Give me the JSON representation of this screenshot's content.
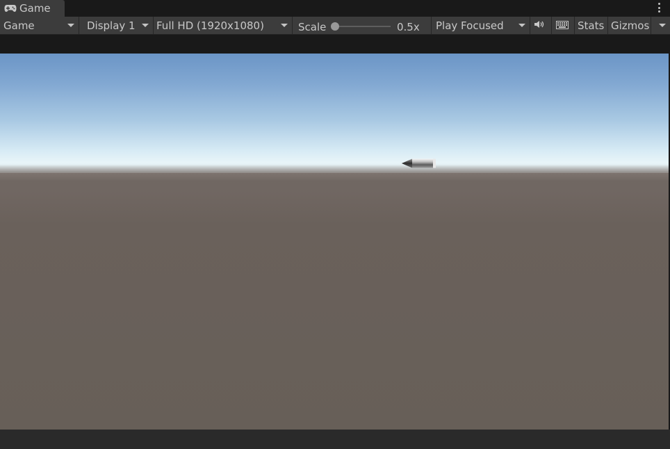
{
  "tab": {
    "title": "Game",
    "icon": "gamepad-icon"
  },
  "toolbar": {
    "view_mode": "Game",
    "display": "Display 1",
    "resolution": "Full HD (1920x1080)",
    "scale_label": "Scale",
    "scale_value": "0.5x",
    "play_mode": "Play Focused",
    "audio_icon": "speaker-icon",
    "keyboard_icon": "keyboard-icon",
    "stats_label": "Stats",
    "gizmos_label": "Gizmos"
  },
  "colors": {
    "panel": "#3c3c3c",
    "background": "#191919",
    "sky_top": "#6b95c6",
    "sky_horizon": "#e9f5f8",
    "ground": "#675f58"
  }
}
